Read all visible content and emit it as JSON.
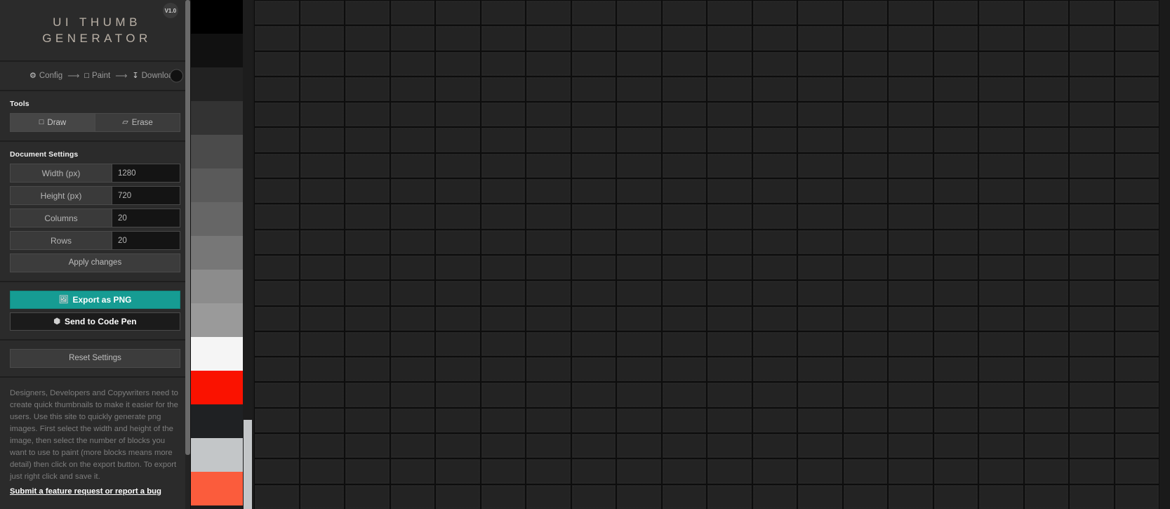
{
  "app": {
    "logo_line1": "UI THUMB",
    "logo_line2": "GENERATOR",
    "version": "V1.0"
  },
  "steps": [
    {
      "icon": "gear-icon",
      "glyph": "⚙",
      "label": "Config"
    },
    {
      "icon": "square-icon",
      "glyph": "□",
      "label": "Paint"
    },
    {
      "icon": "download-icon",
      "glyph": "↧",
      "label": "Download"
    }
  ],
  "step_arrow": "⟶",
  "current_color": "#111111",
  "tools": {
    "title": "Tools",
    "buttons": [
      {
        "label": "Draw",
        "glyph": "□",
        "icon": "pencil-square-icon",
        "active": true
      },
      {
        "label": "Erase",
        "glyph": "▱",
        "icon": "eraser-icon",
        "active": false
      }
    ]
  },
  "document_settings": {
    "title": "Document Settings",
    "fields": [
      {
        "label": "Width (px)",
        "value": "1280"
      },
      {
        "label": "Height (px)",
        "value": "720"
      },
      {
        "label": "Columns",
        "value": "20"
      },
      {
        "label": "Rows",
        "value": "20"
      }
    ],
    "apply_label": "Apply changes"
  },
  "actions": {
    "export_label": "Export as PNG",
    "export_glyph": "Ὓc",
    "export_color": "#169c93",
    "codepen_label": "Send to Code Pen",
    "codepen_glyph": "⬢",
    "reset_label": "Reset Settings"
  },
  "about": {
    "text": "Designers, Developers and Copywriters need to create quick thumbnails to make it easier for the users. Use this site to quickly generate png images. First select the width and height of the image, then select the number of blocks you want to use to paint (more blocks means more detail) then click on the export button. To export just right click and save it.",
    "link_label": "Submit a feature request or report a bug"
  },
  "palette": {
    "swatches": [
      "#000000",
      "#111111",
      "#222222",
      "#333333",
      "#4b4b4b",
      "#5a5a5a",
      "#666666",
      "#777777",
      "#8c8c8c",
      "#9a9a9a",
      "#f5f5f5",
      "#fa1200",
      "#1f2123",
      "#c3c6c8",
      "#fb5c3c"
    ]
  },
  "canvas": {
    "columns": 20,
    "rows": 20,
    "cell_color": "#232323",
    "gridline_color": "#0d0d0d"
  }
}
